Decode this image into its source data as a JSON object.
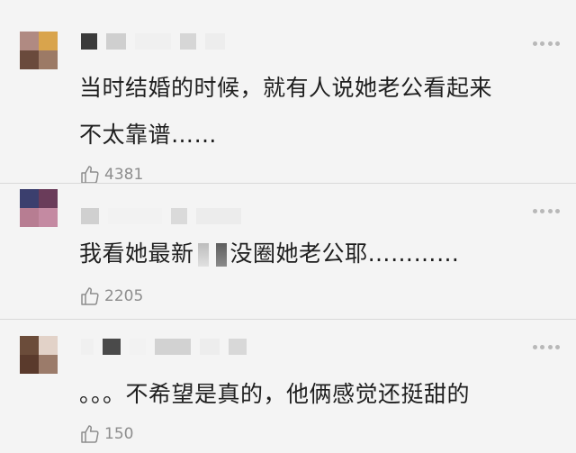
{
  "comments": [
    {
      "text_line1": "当时结婚的时候，就有人说她老公看起来",
      "text_line2": "不太靠谱……",
      "likes": "4381",
      "avatar_colors": [
        "#b08a82",
        "#d9a44c",
        "#6a4a3c",
        "#9c7a66"
      ]
    },
    {
      "text_before": "我看她最新",
      "text_after": "没圈她老公耶…………",
      "likes": "2205",
      "avatar_colors": [
        "#3b3f6e",
        "#6a3c5a",
        "#b77d92",
        "#c48aa2"
      ]
    },
    {
      "text": "。。。不希望是真的，他俩感觉还挺甜的",
      "likes": "150",
      "avatar_colors": [
        "#6b4c3a",
        "#e2d2c8",
        "#5a3a2c",
        "#9b7b6a"
      ]
    }
  ],
  "icons": {
    "like": "thumbs-up-icon",
    "more": "more-dots-icon"
  }
}
